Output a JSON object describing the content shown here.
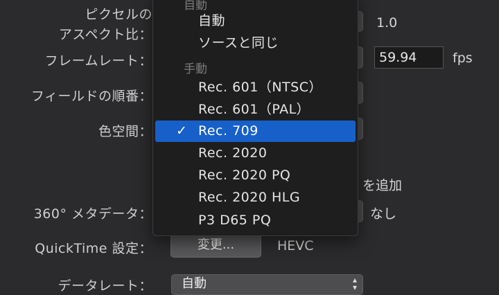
{
  "form": {
    "pixel_aspect_label_line1": "ピクセルの",
    "pixel_aspect_label_line2": "アスペクト比：",
    "pixel_aspect_value": "1.0",
    "frame_rate_label": "フレームレート：",
    "frame_rate_value": "59.94",
    "frame_rate_unit": "fps",
    "field_order_label": "フィールドの順番：",
    "color_space_label": "色空間：",
    "add_suffix_fragment": "を追加",
    "metadata_360_label": "360° メタデータ：",
    "metadata_360_value": "なし",
    "quicktime_label": "QuickTime 設定：",
    "quicktime_button": "変更...",
    "quicktime_codec": "HEVC",
    "data_rate_label": "データレート：",
    "data_rate_value": "自動"
  },
  "menu": {
    "header_auto": "自動",
    "items_auto": [
      "自動",
      "ソースと同じ"
    ],
    "header_manual": "手動",
    "items_manual": [
      "Rec. 601（NTSC）",
      "Rec. 601（PAL）",
      "Rec. 709",
      "Rec. 2020",
      "Rec. 2020 PQ",
      "Rec. 2020 HLG",
      "P3 D65 PQ"
    ],
    "selected": "Rec. 709",
    "check_glyph": "✓"
  },
  "colors": {
    "background": "#2b2b2d",
    "menu_background": "#1e1e1f",
    "selection": "#1760c9"
  }
}
